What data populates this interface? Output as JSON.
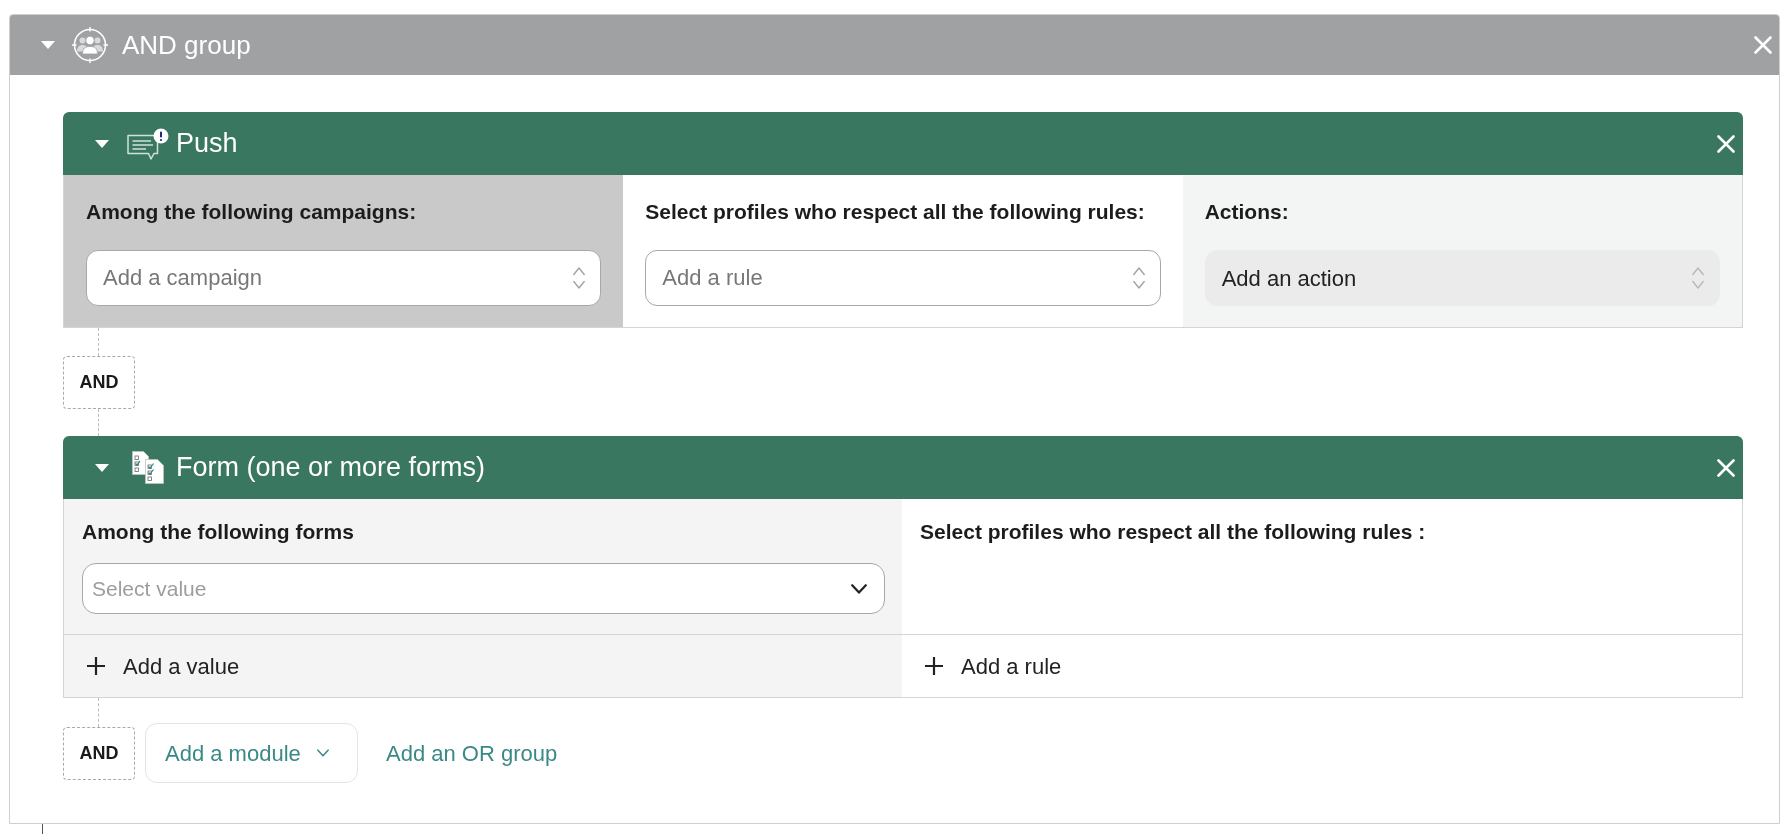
{
  "group": {
    "title": "AND group",
    "expanded": true
  },
  "modules": [
    {
      "kind": "push",
      "title": "Push",
      "expanded": true,
      "sections": [
        {
          "kind": "select",
          "highlighted": true,
          "label": "Among the following campaigns:",
          "placeholder": "Add a campaign"
        },
        {
          "kind": "select",
          "highlighted": false,
          "label": "Select profiles who respect all the following rules:",
          "placeholder": "Add a rule"
        },
        {
          "kind": "action",
          "highlighted": false,
          "label": "Actions:",
          "button": "Add an action"
        }
      ]
    },
    {
      "kind": "form",
      "title": "Form (one or more forms)",
      "expanded": true,
      "sections": [
        {
          "kind": "dropdown",
          "label": "Among the following forms",
          "placeholder": "Select value",
          "add_button": "Add a value"
        },
        {
          "kind": "rules",
          "label": "Select profiles who respect all the following rules :",
          "add_button": "Add a rule"
        }
      ]
    }
  ],
  "connectors": [
    "AND"
  ],
  "footer": {
    "operator": "AND",
    "add_module": "Add a module",
    "add_or_group": "Add an OR group"
  }
}
